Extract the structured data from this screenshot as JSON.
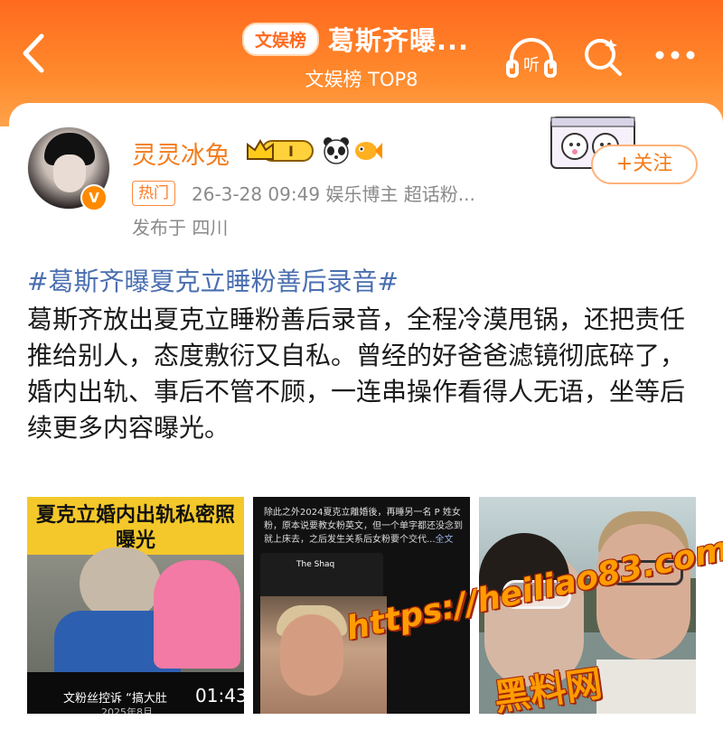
{
  "header": {
    "badge": "文娱榜",
    "title": "葛斯齐曝...",
    "subtitle": "文娱榜 TOP8",
    "listen_label": "听"
  },
  "post": {
    "username": "灵灵冰兔",
    "level_badge": "I",
    "verified_badge": "V",
    "follow_label": "+关注",
    "hot_tag": "热门",
    "meta": "26-3-28 09:49  娱乐博主 超话粉...",
    "location": "发布于 四川",
    "hashtag": "#葛斯齐曝夏克立睡粉善后录音#",
    "body": "葛斯齐放出夏克立睡粉善后录音，全程冷漠甩锅，还把责任推给别人，态度敷衍又自私。曾经的好爸爸滤镜彻底碎了，婚内出轨、事后不管不顾，一连串操作看得人无语，坐等后续更多内容曝光。"
  },
  "images": {
    "img1": {
      "caption_line1": "夏克立婚内出轨私密照",
      "caption_line2": "曝光",
      "complaint": "文粉丝控诉 “搞大肚",
      "year": "2025年8月",
      "duration": "01:43"
    },
    "img2": {
      "text": "除此之外2024夏克立離婚後，再睡另一名 P 姓女粉，原本说要教女粉英文，但一个单字都还没念到就上床去，之后发生关系后女粉要个交代...",
      "more": "全文",
      "phone_title": "The Shaq"
    }
  },
  "watermark": {
    "url": "https://heiliao83.com",
    "name": "黑料网"
  },
  "colors": {
    "header_orange": "#ff6a1f",
    "username_orange": "#f37c1c",
    "hashtag_blue": "#4a6fb0"
  }
}
